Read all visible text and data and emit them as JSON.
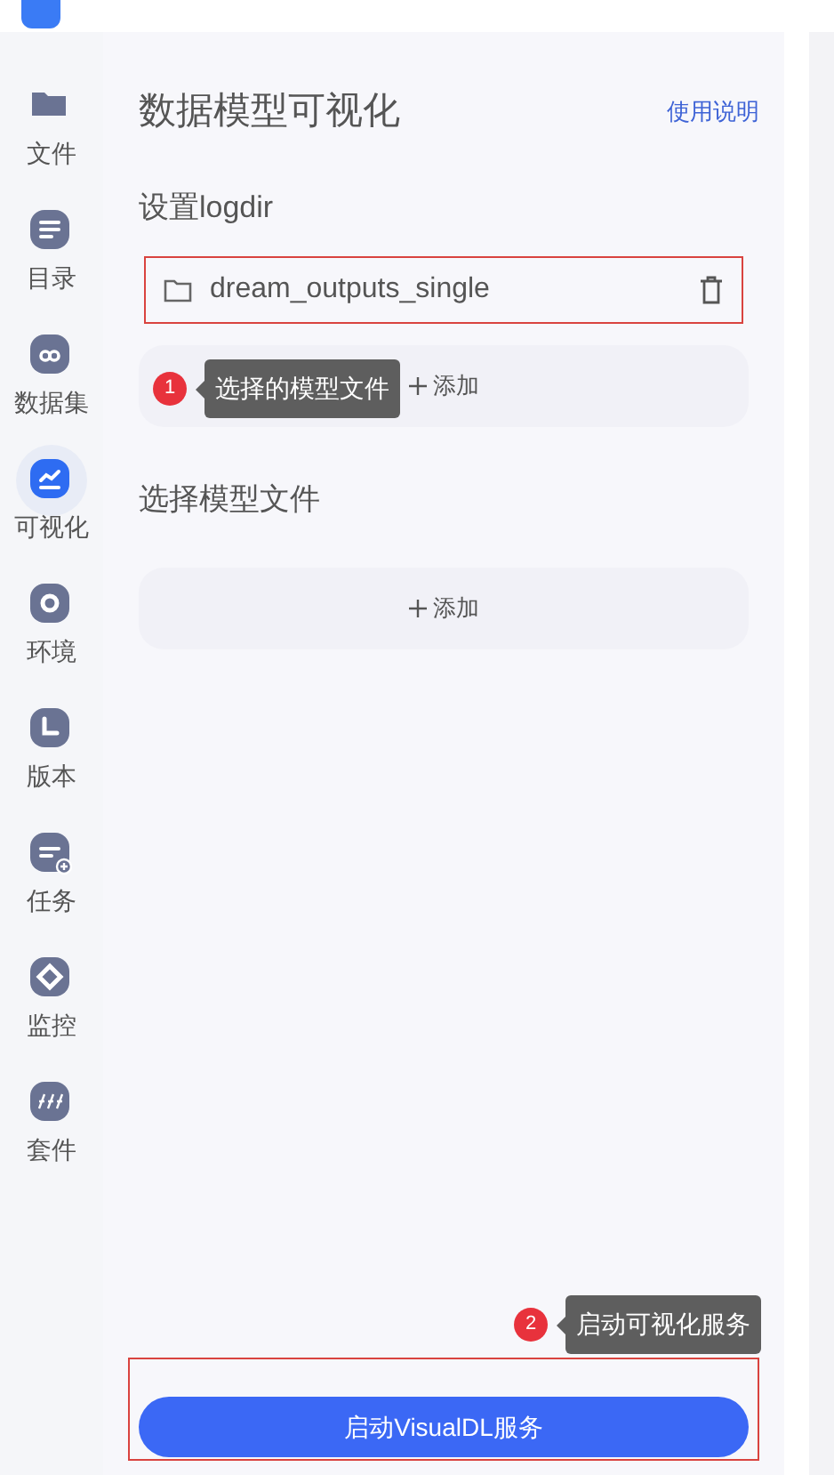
{
  "sidebar": {
    "items": [
      {
        "label": "文件",
        "selected": false
      },
      {
        "label": "目录",
        "selected": false
      },
      {
        "label": "数据集",
        "selected": false
      },
      {
        "label": "可视化",
        "selected": true
      },
      {
        "label": "环境",
        "selected": false
      },
      {
        "label": "版本",
        "selected": false
      },
      {
        "label": "任务",
        "selected": false
      },
      {
        "label": "监控",
        "selected": false
      },
      {
        "label": "套件",
        "selected": false
      }
    ]
  },
  "panel": {
    "title": "数据模型可视化",
    "help_link": "使用说明",
    "sections": [
      {
        "title": "设置logdir",
        "entries": [
          {
            "name": "dream_outputs_single",
            "highlighted": true
          }
        ],
        "add_label": "添加"
      },
      {
        "title": "选择模型文件",
        "add_label": "添加"
      }
    ],
    "start_button": {
      "label": "启动VisualDL服务",
      "highlighted": true
    }
  },
  "callouts": [
    {
      "number": "1",
      "text": "选择的模型文件"
    },
    {
      "number": "2",
      "text": "启动可视化服务"
    }
  ]
}
